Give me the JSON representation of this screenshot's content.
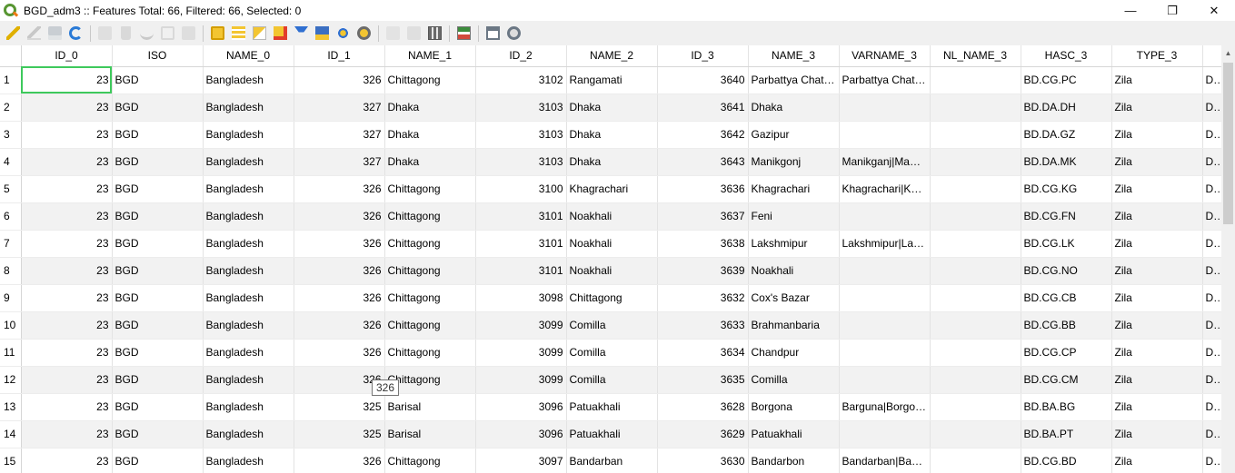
{
  "window": {
    "title": "BGD_adm3 :: Features Total: 66, Filtered: 66, Selected: 0",
    "minimize": "—",
    "restore": "❐",
    "close": "✕"
  },
  "toolbar": {
    "groups": [
      [
        "toggle-editing-icon",
        "multi-edit-icon",
        "save-edits-icon",
        "reload-icon"
      ],
      [
        "add-feature-icon",
        "delete-feature-icon",
        "cut-icon",
        "copy-icon",
        "paste-icon"
      ],
      [
        "select-by-expression-icon",
        "select-all-icon",
        "invert-selection-icon",
        "deselect-all-icon",
        "filter-select-icon",
        "move-selection-top-icon",
        "pan-to-selection-icon",
        "zoom-to-selection-icon"
      ],
      [
        "new-field-icon",
        "delete-field-icon",
        "field-calculator-icon"
      ],
      [
        "conditional-formatting-icon"
      ],
      [
        "dock-table-icon",
        "actions-icon"
      ]
    ]
  },
  "table": {
    "columns": [
      "ID_0",
      "ISO",
      "NAME_0",
      "ID_1",
      "NAME_1",
      "ID_2",
      "NAME_2",
      "ID_3",
      "NAME_3",
      "VARNAME_3",
      "NL_NAME_3",
      "HASC_3",
      "TYPE_3",
      ""
    ],
    "rows": [
      [
        "1",
        "23",
        "BGD",
        "Bangladesh",
        "326",
        "Chittagong",
        "3102",
        "Rangamati",
        "3640",
        "Parbattya Chatt…",
        "Parbattya Chatt…",
        "",
        "BD.CG.PC",
        "Zila",
        "Dis"
      ],
      [
        "2",
        "23",
        "BGD",
        "Bangladesh",
        "327",
        "Dhaka",
        "3103",
        "Dhaka",
        "3641",
        "Dhaka",
        "",
        "",
        "BD.DA.DH",
        "Zila",
        "Dis"
      ],
      [
        "3",
        "23",
        "BGD",
        "Bangladesh",
        "327",
        "Dhaka",
        "3103",
        "Dhaka",
        "3642",
        "Gazipur",
        "",
        "",
        "BD.DA.GZ",
        "Zila",
        "Dis"
      ],
      [
        "4",
        "23",
        "BGD",
        "Bangladesh",
        "327",
        "Dhaka",
        "3103",
        "Dhaka",
        "3643",
        "Manikgonj",
        "Manikganj|Man…",
        "",
        "BD.DA.MK",
        "Zila",
        "Dis"
      ],
      [
        "5",
        "23",
        "BGD",
        "Bangladesh",
        "326",
        "Chittagong",
        "3100",
        "Khagrachari",
        "3636",
        "Khagrachari",
        "Khagrachari|Kh…",
        "",
        "BD.CG.KG",
        "Zila",
        "Dis"
      ],
      [
        "6",
        "23",
        "BGD",
        "Bangladesh",
        "326",
        "Chittagong",
        "3101",
        "Noakhali",
        "3637",
        "Feni",
        "",
        "",
        "BD.CG.FN",
        "Zila",
        "Dis"
      ],
      [
        "7",
        "23",
        "BGD",
        "Bangladesh",
        "326",
        "Chittagong",
        "3101",
        "Noakhali",
        "3638",
        "Lakshmipur",
        "Lakshmipur|Lak…",
        "",
        "BD.CG.LK",
        "Zila",
        "Dis"
      ],
      [
        "8",
        "23",
        "BGD",
        "Bangladesh",
        "326",
        "Chittagong",
        "3101",
        "Noakhali",
        "3639",
        "Noakhali",
        "",
        "",
        "BD.CG.NO",
        "Zila",
        "Dis"
      ],
      [
        "9",
        "23",
        "BGD",
        "Bangladesh",
        "326",
        "Chittagong",
        "3098",
        "Chittagong",
        "3632",
        "Cox's Bazar",
        "",
        "",
        "BD.CG.CB",
        "Zila",
        "Dis"
      ],
      [
        "10",
        "23",
        "BGD",
        "Bangladesh",
        "326",
        "Chittagong",
        "3099",
        "Comilla",
        "3633",
        "Brahmanbaria",
        "",
        "",
        "BD.CG.BB",
        "Zila",
        "Dis"
      ],
      [
        "11",
        "23",
        "BGD",
        "Bangladesh",
        "326",
        "Chittagong",
        "3099",
        "Comilla",
        "3634",
        "Chandpur",
        "",
        "",
        "BD.CG.CP",
        "Zila",
        "Dis"
      ],
      [
        "12",
        "23",
        "BGD",
        "Bangladesh",
        "326",
        "Chittagong",
        "3099",
        "Comilla",
        "3635",
        "Comilla",
        "",
        "",
        "BD.CG.CM",
        "Zila",
        "Dis"
      ],
      [
        "13",
        "23",
        "BGD",
        "Bangladesh",
        "325",
        "Barisal",
        "3096",
        "Patuakhali",
        "3628",
        "Borgona",
        "Barguna|Borgona",
        "",
        "BD.BA.BG",
        "Zila",
        "Dis"
      ],
      [
        "14",
        "23",
        "BGD",
        "Bangladesh",
        "325",
        "Barisal",
        "3096",
        "Patuakhali",
        "3629",
        "Patuakhali",
        "",
        "",
        "BD.BA.PT",
        "Zila",
        "Dis"
      ],
      [
        "15",
        "23",
        "BGD",
        "Bangladesh",
        "326",
        "Chittagong",
        "3097",
        "Bandarban",
        "3630",
        "Bandarbon",
        "Bandarban|Ban…",
        "",
        "BD.CG.BD",
        "Zila",
        "Dis"
      ]
    ],
    "numeric_columns": [
      0,
      3,
      5,
      7
    ],
    "tooltip": "326"
  },
  "colors": {
    "selection_outline": "#3ec95c",
    "alt_row": "#f2f2f2",
    "qgis_green": "#589632",
    "qgis_orange": "#ee7913"
  }
}
